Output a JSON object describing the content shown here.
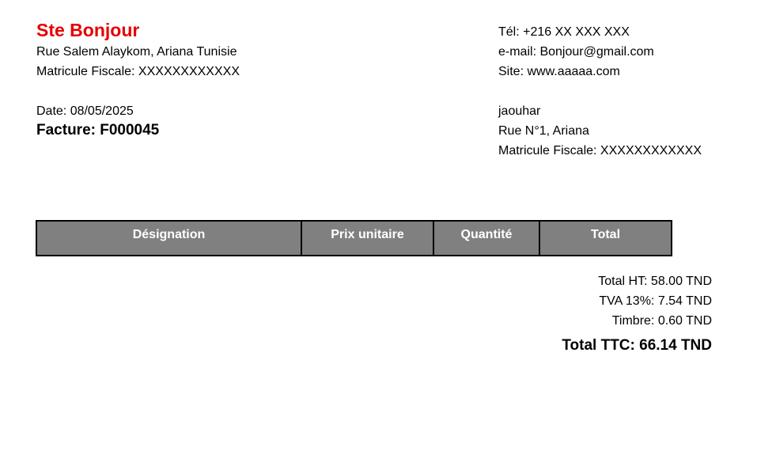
{
  "company": {
    "name": "Ste Bonjour",
    "address": "Rue Salem Alaykom, Ariana Tunisie",
    "matricule": "Matricule Fiscale: XXXXXXXXXXXX",
    "tel": "Tél: +216 XX XXX XXX",
    "email": "e-mail: Bonjour@gmail.com",
    "site": "Site: www.aaaaa.com",
    "name_color": "#e60000"
  },
  "invoice": {
    "date": "Date: 08/05/2025",
    "number": "Facture: F000045"
  },
  "client": {
    "name": "jaouhar",
    "address": "Rue N°1, Ariana",
    "matricule": "Matricule Fiscale: XXXXXXXXXXXX"
  },
  "table": {
    "header_color": "#808080",
    "columns": [
      "Désignation",
      "Prix unitaire",
      "Quantité",
      "Total"
    ],
    "rows": []
  },
  "totals": {
    "ht": "Total HT: 58.00 TND",
    "tva": "TVA 13%: 7.54 TND",
    "timbre": "Timbre: 0.60 TND",
    "ttc": "Total TTC: 66.14 TND"
  }
}
